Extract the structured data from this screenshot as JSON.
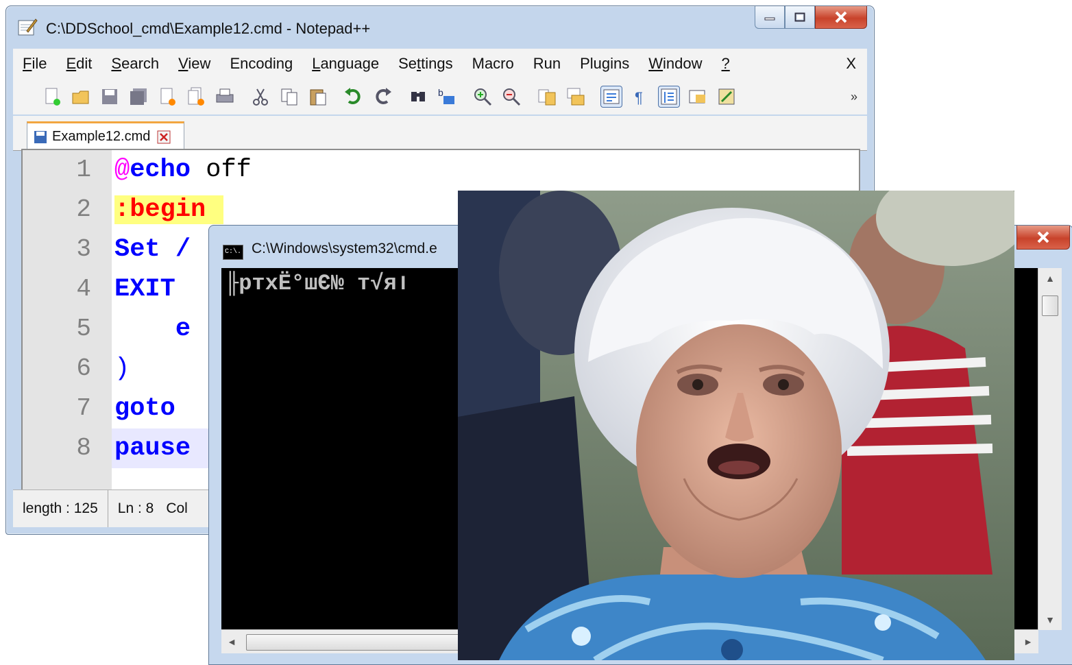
{
  "notepad": {
    "title": "C:\\DDSchool_cmd\\Example12.cmd - Notepad++",
    "menu": [
      {
        "pre": "",
        "u": "F",
        "post": "ile"
      },
      {
        "pre": "",
        "u": "E",
        "post": "dit"
      },
      {
        "pre": "",
        "u": "S",
        "post": "earch"
      },
      {
        "pre": "",
        "u": "V",
        "post": "iew"
      },
      {
        "pre": "Encoding",
        "u": "",
        "post": ""
      },
      {
        "pre": "",
        "u": "L",
        "post": "anguage"
      },
      {
        "pre": "Se",
        "u": "t",
        "post": "tings"
      },
      {
        "pre": "Macro",
        "u": "",
        "post": ""
      },
      {
        "pre": "Run",
        "u": "",
        "post": ""
      },
      {
        "pre": "Plugins",
        "u": "",
        "post": ""
      },
      {
        "pre": "",
        "u": "W",
        "post": "indow"
      },
      {
        "pre": "",
        "u": "?",
        "post": ""
      }
    ],
    "menu_close": "X",
    "toolbar_overflow": "»",
    "tab_label": "Example12.cmd",
    "lines": [
      "1",
      "2",
      "3",
      "4",
      "5",
      "6",
      "7",
      "8"
    ],
    "code": {
      "l1_at": "@",
      "l1_kw": "echo",
      "l1_rest": " off",
      "l2": ":begin",
      "l3": "Set /",
      "l4": "EXIT",
      "l5": "    e",
      "l6": ")",
      "l7": "goto",
      "l8": "pause"
    },
    "status": {
      "length": "length : 125",
      "ln": "Ln : 8",
      "col": "Col"
    }
  },
  "cmd": {
    "title": "C:\\Windows\\system32\\cmd.e",
    "icon_text": "C:\\.",
    "output": "╟ртхЁ°шЄ№ т√яו"
  },
  "colors": {
    "titlebar": "#c4d6ec",
    "close_button": "#c8432b",
    "gutter": "#e4e4e4",
    "keyword": "#0000ff",
    "label": "#ff0000",
    "label_bg": "#ffff80",
    "console_bg": "#000000"
  }
}
